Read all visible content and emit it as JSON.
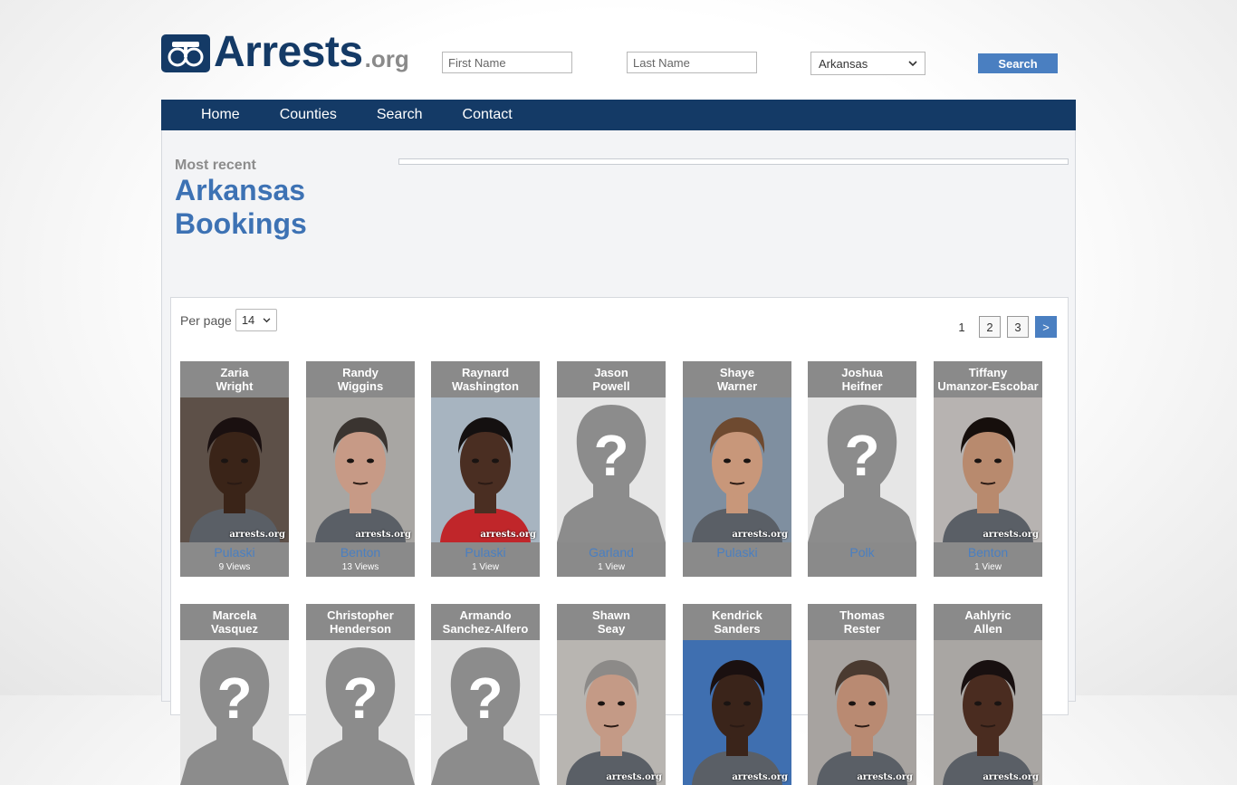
{
  "header": {
    "logo_main": "Arrests",
    "logo_suffix": ".org",
    "first_name_placeholder": "First Name",
    "last_name_placeholder": "Last Name",
    "state_select": "Arkansas",
    "search_label": "Search"
  },
  "nav": [
    "Home",
    "Counties",
    "Search",
    "Contact"
  ],
  "section": {
    "kicker": "Most recent",
    "title_line1": "Arkansas",
    "title_line2": "Bookings"
  },
  "controls": {
    "per_page_label": "Per page",
    "per_page_value": "14",
    "pages": [
      "1",
      "2",
      "3"
    ],
    "next_label": ">"
  },
  "colors": {
    "navy": "#143a66",
    "accent": "#4a7fc1",
    "card_gray": "#8a8a8a"
  },
  "watermark": "arrests.org",
  "inmates_row1": [
    {
      "first": "Zaria",
      "last": "Wright",
      "county": "Pulaski",
      "views": "9 Views",
      "photo": "mugshot",
      "skin": "#3a2418",
      "hair": "#1a1010",
      "bg": "#5d5048"
    },
    {
      "first": "Randy",
      "last": "Wiggins",
      "county": "Benton",
      "views": "13 Views",
      "photo": "mugshot",
      "skin": "#c79a86",
      "hair": "#3a3430",
      "bg": "#a8a6a3"
    },
    {
      "first": "Raynard",
      "last": "Washington",
      "county": "Pulaski",
      "views": "1 View",
      "photo": "mugshot",
      "skin": "#4a2e22",
      "hair": "#141010",
      "bg": "#a7b4c0",
      "shirt": "#c0262a"
    },
    {
      "first": "Jason",
      "last": "Powell",
      "county": "Garland",
      "views": "1 View",
      "photo": "placeholder"
    },
    {
      "first": "Shaye",
      "last": "Warner",
      "county": "Pulaski",
      "views": "",
      "photo": "mugshot",
      "skin": "#c8977a",
      "hair": "#6e4a30",
      "bg": "#7f8fa0"
    },
    {
      "first": "Joshua",
      "last": "Heifner",
      "county": "Polk",
      "views": "",
      "photo": "placeholder"
    },
    {
      "first": "Tiffany",
      "last": "Umanzor-Escobar",
      "county": "Benton",
      "views": "1 View",
      "photo": "mugshot",
      "skin": "#b88a6e",
      "hair": "#160f0c",
      "bg": "#b7b3b1"
    }
  ],
  "inmates_row2": [
    {
      "first": "Marcela",
      "last": "Vasquez",
      "photo": "placeholder"
    },
    {
      "first": "Christopher",
      "last": "Henderson",
      "photo": "placeholder"
    },
    {
      "first": "Armando",
      "last": "Sanchez-Alfero",
      "photo": "placeholder"
    },
    {
      "first": "Shawn",
      "last": "Seay",
      "photo": "mugshot",
      "skin": "#c49a86",
      "hair": "#8c8a88",
      "bg": "#b8b5b1"
    },
    {
      "first": "Kendrick",
      "last": "Sanders",
      "photo": "mugshot",
      "skin": "#3a241a",
      "hair": "#1a1010",
      "bg": "#3f6fb0"
    },
    {
      "first": "Thomas",
      "last": "Rester",
      "photo": "mugshot",
      "skin": "#b98a72",
      "hair": "#4a3a30",
      "bg": "#a7a3a0"
    },
    {
      "first": "Aahlyric",
      "last": "Allen",
      "photo": "mugshot",
      "skin": "#4a2c20",
      "hair": "#181010",
      "bg": "#a9a6a3"
    }
  ]
}
